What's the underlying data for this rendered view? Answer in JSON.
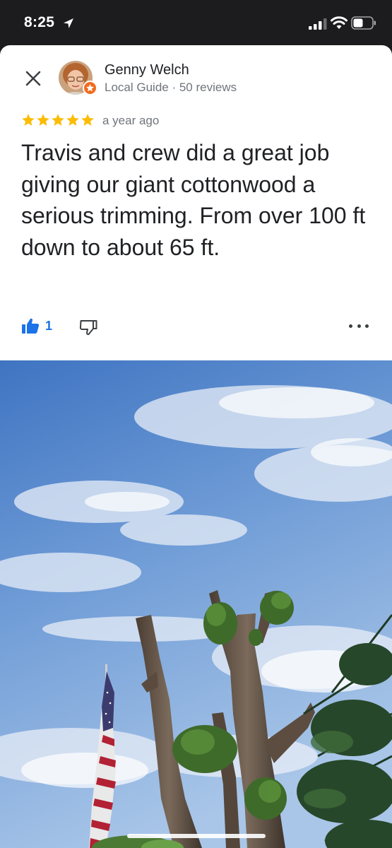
{
  "status_bar": {
    "time": "8:25",
    "icons": [
      "location-arrow-icon",
      "cellular-signal-icon",
      "wifi-icon",
      "battery-icon"
    ]
  },
  "review": {
    "reviewer": {
      "name": "Genny Welch",
      "meta": "Local Guide · 50 reviews",
      "badge_icon": "local-guide-star-icon",
      "badge_color": "#f26b1d"
    },
    "rating": 5,
    "rating_color": "#fbbc04",
    "date": "a year ago",
    "text": "Travis and crew did a great job giving our giant cottonwood a serious trimming. From over 100 ft down to about 65 ft.",
    "likes": "1",
    "like_color": "#1a73e8"
  },
  "photo": {
    "subject": "review-photo"
  }
}
